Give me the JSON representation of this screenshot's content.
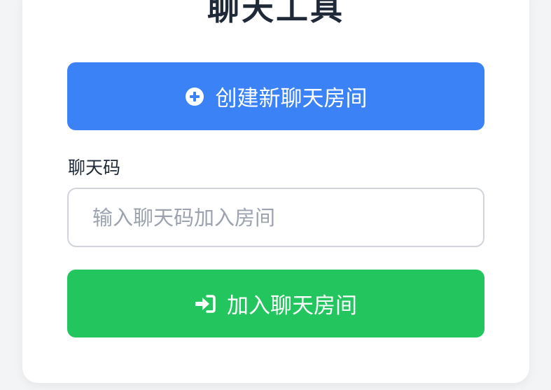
{
  "title": "聊天工具",
  "create_button": {
    "label": "创建新聊天房间",
    "icon": "plus-circle-icon"
  },
  "chat_code": {
    "label": "聊天码",
    "placeholder": "输入聊天码加入房间",
    "value": ""
  },
  "join_button": {
    "label": "加入聊天房间",
    "icon": "sign-in-icon"
  },
  "colors": {
    "primary": "#3b82f6",
    "success": "#22c55e",
    "background": "#f3f4f6",
    "card": "#ffffff",
    "text": "#1f2937"
  }
}
